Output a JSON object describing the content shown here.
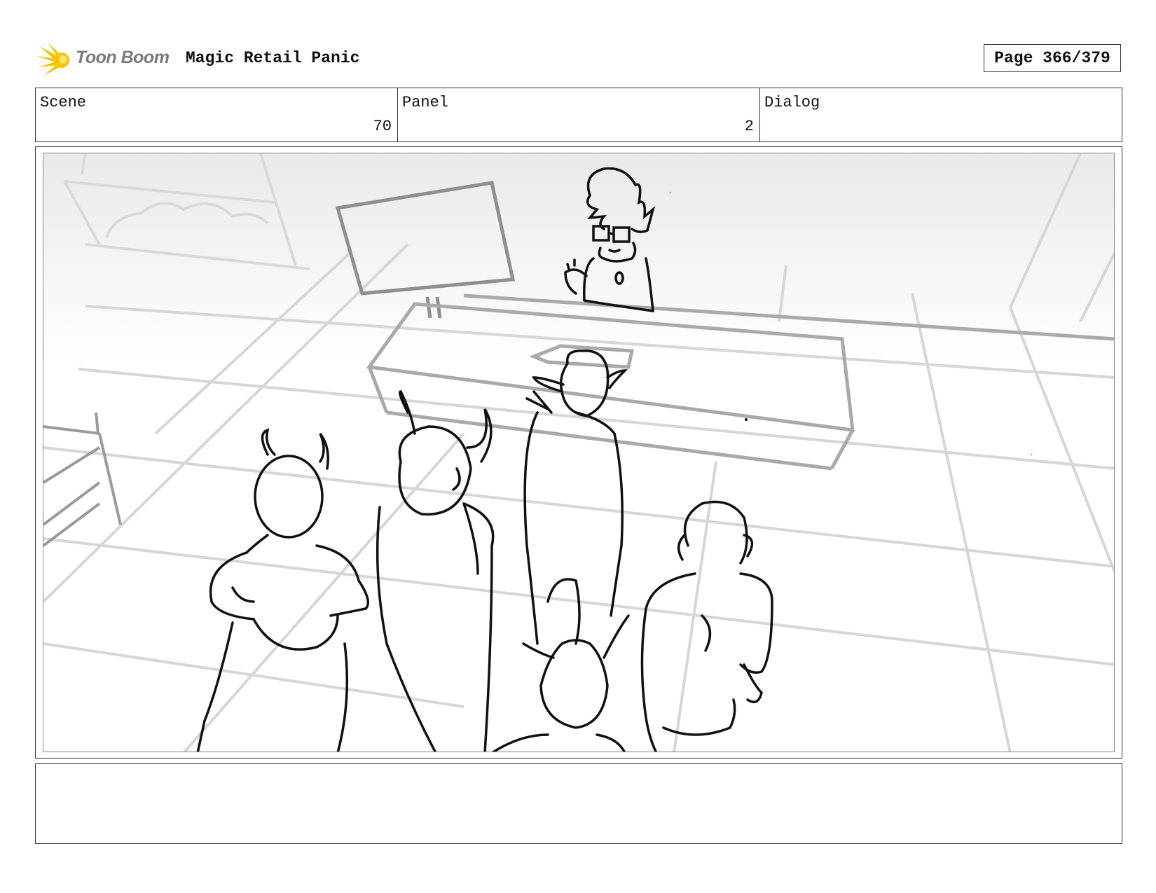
{
  "header": {
    "logo_text": "Toon Boom",
    "project_title": "Magic Retail Panic",
    "page_label": "Page 366/379"
  },
  "info_table": {
    "scene_label": "Scene",
    "scene_value": "70",
    "panel_label": "Panel",
    "panel_value": "2",
    "dialog_label": "Dialog",
    "dialog_value": ""
  },
  "notes": {
    "text": ""
  },
  "colors": {
    "logo_accent": "#f5c400",
    "sketch_line": "#111111",
    "background_line": "#cfcfcf"
  }
}
